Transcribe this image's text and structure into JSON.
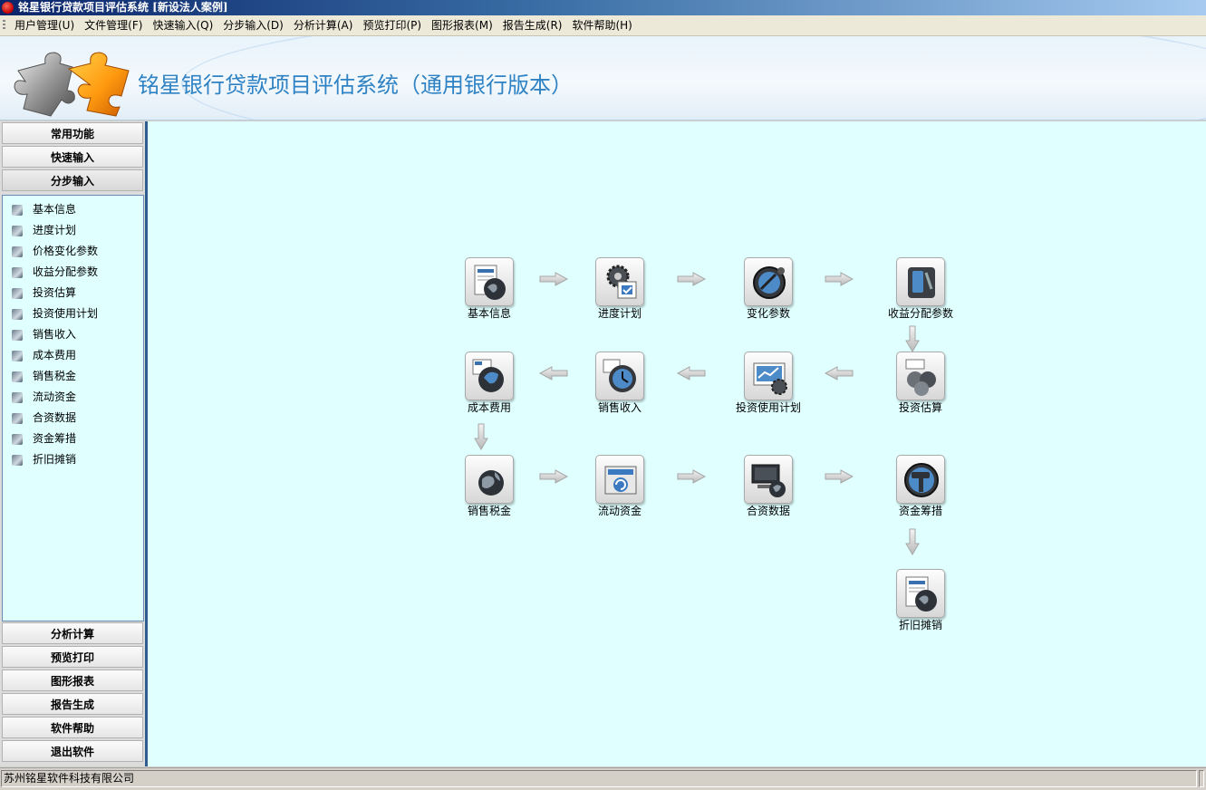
{
  "window": {
    "title": "铭星银行贷款项目评估系统 [新设法人案例]"
  },
  "menu": [
    "用户管理(U)",
    "文件管理(F)",
    "快速输入(Q)",
    "分步输入(D)",
    "分析计算(A)",
    "预览打印(P)",
    "图形报表(M)",
    "报告生成(R)",
    "软件帮助(H)"
  ],
  "banner": {
    "title": "铭星银行贷款项目评估系统（通用银行版本）"
  },
  "sidebar": {
    "top_buttons": [
      "常用功能",
      "快速输入",
      "分步输入"
    ],
    "items": [
      "基本信息",
      "进度计划",
      "价格变化参数",
      "收益分配参数",
      "投资估算",
      "投资使用计划",
      "销售收入",
      "成本费用",
      "销售税金",
      "流动资金",
      "合资数据",
      "资金筹措",
      "折旧摊销"
    ],
    "bottom_buttons": [
      "分析计算",
      "预览打印",
      "图形报表",
      "报告生成",
      "软件帮助",
      "退出软件"
    ]
  },
  "flow": {
    "nodes": [
      "基本信息",
      "进度计划",
      "变化参数",
      "收益分配参数",
      "成本费用",
      "销售收入",
      "投资使用计划",
      "投资估算",
      "销售税金",
      "流动资金",
      "合资数据",
      "资金筹措",
      "折旧摊销"
    ],
    "icons": [
      "document-globe-icon",
      "gear-checklist-icon",
      "compass-icon",
      "phone-device-icon",
      "globe-gear-icon",
      "clock-icon",
      "monitor-chart-icon",
      "coins-icon",
      "globe-icon",
      "refresh-box-icon",
      "computer-globe-icon",
      "hammer-icon",
      "document-globe-icon"
    ]
  },
  "status": {
    "company": "苏州铭星软件科技有限公司"
  },
  "colors": {
    "canvas": "#e0ffff",
    "banner_title": "#2f83c4",
    "sidebar_edge": "#2f5d91"
  }
}
